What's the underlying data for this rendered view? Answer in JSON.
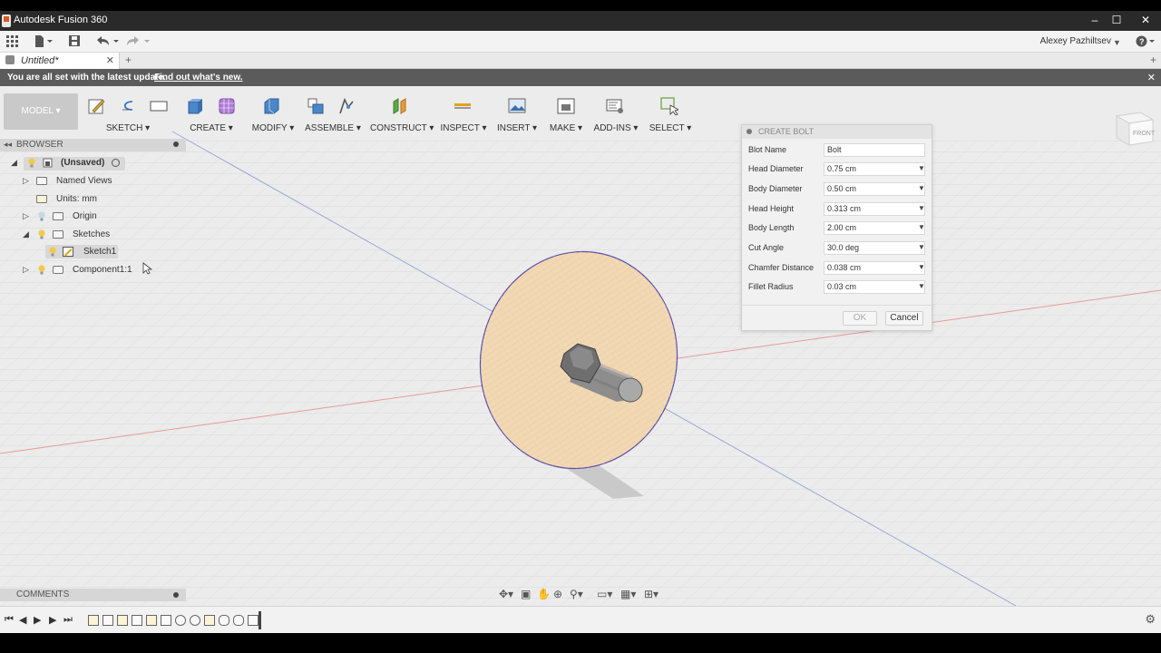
{
  "window": {
    "title": "Autodesk Fusion 360",
    "controls": [
      "–",
      "☐",
      "✕"
    ]
  },
  "quick_access": {
    "user_name": "Alexey Pazhiltsev"
  },
  "document_tab": {
    "name": "Untitled*"
  },
  "notification": {
    "message": "You are all set with the latest update.",
    "link": "Find out what's new."
  },
  "ribbon": {
    "workspace": "MODEL ▾",
    "groups": [
      {
        "label": "SKETCH ▾"
      },
      {
        "label": "CREATE ▾"
      },
      {
        "label": "MODIFY ▾"
      },
      {
        "label": "ASSEMBLE ▾"
      },
      {
        "label": "CONSTRUCT ▾"
      },
      {
        "label": "INSPECT ▾"
      },
      {
        "label": "INSERT ▾"
      },
      {
        "label": "MAKE ▾"
      },
      {
        "label": "ADD-INS ▾"
      },
      {
        "label": "SELECT ▾"
      }
    ]
  },
  "browser": {
    "title": "BROWSER",
    "items": [
      {
        "label": "(Unsaved)"
      },
      {
        "label": "Named Views"
      },
      {
        "label": "Units: mm"
      },
      {
        "label": "Origin"
      },
      {
        "label": "Sketches"
      },
      {
        "label": "Sketch1"
      },
      {
        "label": "Component1:1"
      }
    ]
  },
  "comments": {
    "title": "COMMENTS"
  },
  "viewcube": {
    "face": "FRONT"
  },
  "dialog": {
    "title": "CREATE BOLT",
    "fields": [
      {
        "label": "Blot Name",
        "value": "Bolt"
      },
      {
        "label": "Head Diameter",
        "value": "0.75 cm"
      },
      {
        "label": "Body Diameter",
        "value": "0.50 cm"
      },
      {
        "label": "Head Height",
        "value": "0.313 cm"
      },
      {
        "label": "Body Length",
        "value": "2.00 cm"
      },
      {
        "label": "Cut Angle",
        "value": "30.0 deg"
      },
      {
        "label": "Chamfer Distance",
        "value": "0.038 cm"
      },
      {
        "label": "Fillet Radius",
        "value": "0.03 cm"
      }
    ],
    "ok_label": "OK",
    "cancel_label": "Cancel"
  },
  "colors": {
    "sketch_fill": "#f2d9b4",
    "sketch_edge": "#5a4aa8",
    "viewport_bg": "#ececec",
    "notification_bg": "#5b5b5b"
  }
}
